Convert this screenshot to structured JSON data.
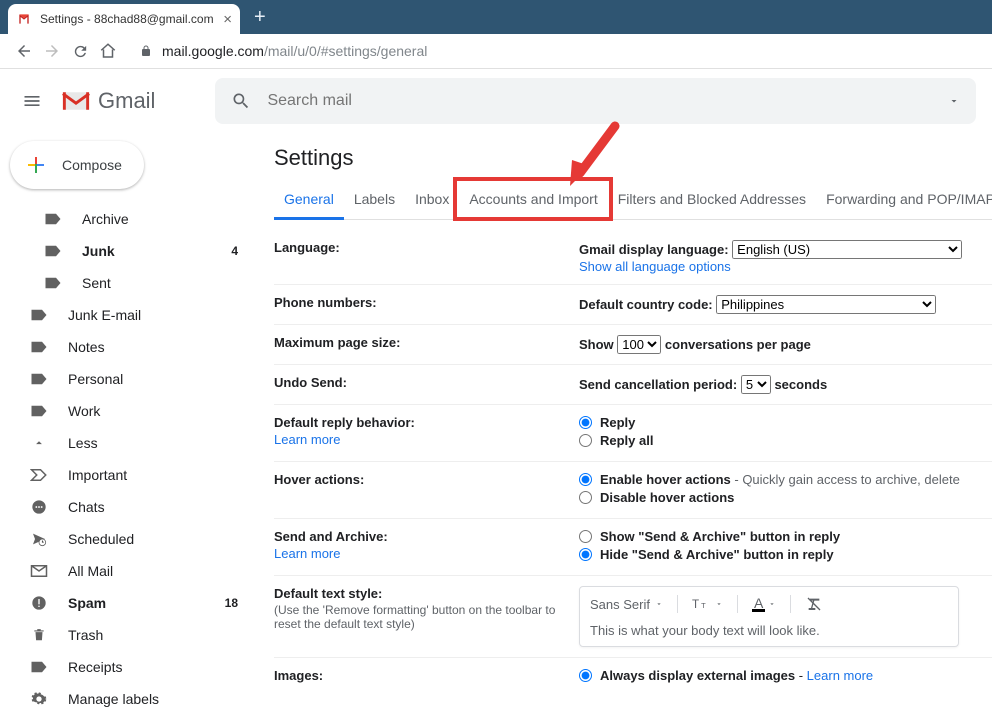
{
  "browser": {
    "tab_title": "Settings - 88chad88@gmail.com",
    "url_host": "mail.google.com",
    "url_path": "/mail/u/0/#settings/general"
  },
  "header": {
    "product_name": "Gmail",
    "search_placeholder": "Search mail"
  },
  "sidebar": {
    "compose_label": "Compose",
    "items": [
      {
        "label": "Archive",
        "bold": false,
        "count": "",
        "icon": "label",
        "indent": true
      },
      {
        "label": "Junk",
        "bold": true,
        "count": "4",
        "icon": "label",
        "indent": true
      },
      {
        "label": "Sent",
        "bold": false,
        "count": "",
        "icon": "label",
        "indent": true
      },
      {
        "label": "Junk E-mail",
        "bold": false,
        "count": "",
        "icon": "label",
        "indent": false
      },
      {
        "label": "Notes",
        "bold": false,
        "count": "",
        "icon": "label",
        "indent": false
      },
      {
        "label": "Personal",
        "bold": false,
        "count": "",
        "icon": "label",
        "indent": false
      },
      {
        "label": "Work",
        "bold": false,
        "count": "",
        "icon": "label",
        "indent": false
      },
      {
        "label": "Less",
        "bold": false,
        "count": "",
        "icon": "chevron-up",
        "indent": false
      },
      {
        "label": "Important",
        "bold": false,
        "count": "",
        "icon": "important",
        "indent": false
      },
      {
        "label": "Chats",
        "bold": false,
        "count": "",
        "icon": "chat",
        "indent": false
      },
      {
        "label": "Scheduled",
        "bold": false,
        "count": "",
        "icon": "scheduled",
        "indent": false
      },
      {
        "label": "All Mail",
        "bold": false,
        "count": "",
        "icon": "allmail",
        "indent": false
      },
      {
        "label": "Spam",
        "bold": true,
        "count": "18",
        "icon": "spam",
        "indent": false
      },
      {
        "label": "Trash",
        "bold": false,
        "count": "",
        "icon": "trash",
        "indent": false
      },
      {
        "label": "Receipts",
        "bold": false,
        "count": "",
        "icon": "label",
        "indent": false
      },
      {
        "label": "Manage labels",
        "bold": false,
        "count": "",
        "icon": "gear",
        "indent": false
      }
    ]
  },
  "settings": {
    "title": "Settings",
    "tabs": [
      "General",
      "Labels",
      "Inbox",
      "Accounts and Import",
      "Filters and Blocked Addresses",
      "Forwarding and POP/IMAP"
    ],
    "active_tab_index": 0,
    "highlight_tab_index": 3,
    "rows": {
      "language": {
        "label": "Language:",
        "value_label": "Gmail display language:",
        "select_value": "English (US)",
        "link": "Show all language options"
      },
      "phone": {
        "label": "Phone numbers:",
        "value_label": "Default country code:",
        "select_value": "Philippines"
      },
      "page_size": {
        "label": "Maximum page size:",
        "prefix": "Show",
        "select_value": "100",
        "suffix": "conversations per page"
      },
      "undo": {
        "label": "Undo Send:",
        "prefix": "Send cancellation period:",
        "select_value": "5",
        "suffix": "seconds"
      },
      "reply": {
        "label": "Default reply behavior:",
        "learn_more": "Learn more",
        "opt1": "Reply",
        "opt2": "Reply all"
      },
      "hover": {
        "label": "Hover actions:",
        "opt1": "Enable hover actions",
        "opt1_desc": " - Quickly gain access to archive, delete",
        "opt2": "Disable hover actions"
      },
      "send_archive": {
        "label": "Send and Archive:",
        "learn_more": "Learn more",
        "opt1": "Show \"Send & Archive\" button in reply",
        "opt2": "Hide \"Send & Archive\" button in reply"
      },
      "text_style": {
        "label": "Default text style:",
        "sub": "(Use the 'Remove formatting' button on the toolbar to reset the default text style)",
        "font_name": "Sans Serif",
        "preview": "This is what your body text will look like."
      },
      "images": {
        "label": "Images:",
        "opt1": "Always display external images",
        "learn_more": "Learn more"
      }
    }
  }
}
